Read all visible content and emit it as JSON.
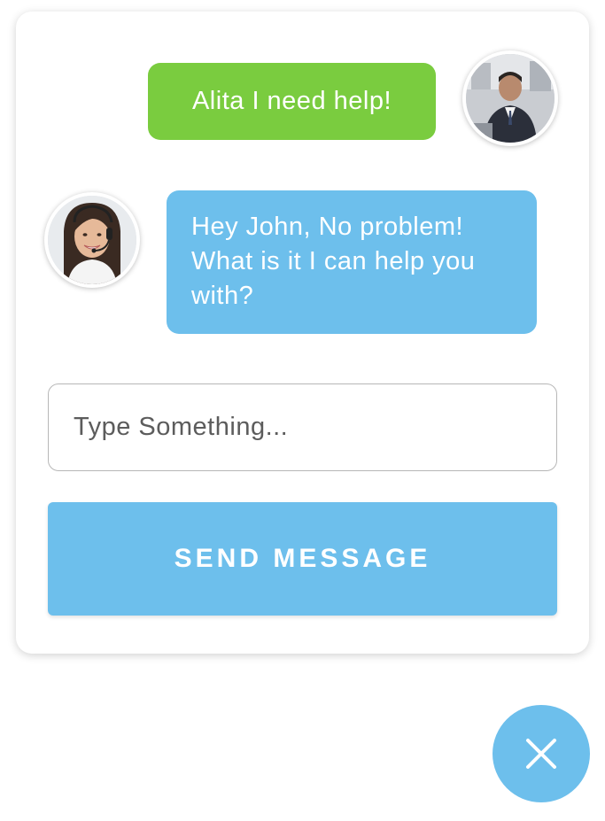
{
  "conversation": {
    "user_message": "Alita I need help!",
    "agent_message_lines": [
      "Hey John, No problem!",
      "What is it I can help you",
      "with?"
    ]
  },
  "composer": {
    "placeholder": "Type Something...",
    "value": ""
  },
  "send_button": {
    "label": "SEND MESSAGE"
  },
  "icons": {
    "user_avatar": "avatar-john",
    "agent_avatar": "avatar-alita-headset",
    "close": "close-icon"
  },
  "colors": {
    "user_bubble": "#7acc3f",
    "agent_bubble": "#6dbfec",
    "send_button": "#6dbfec",
    "fab": "#6dbfec"
  }
}
